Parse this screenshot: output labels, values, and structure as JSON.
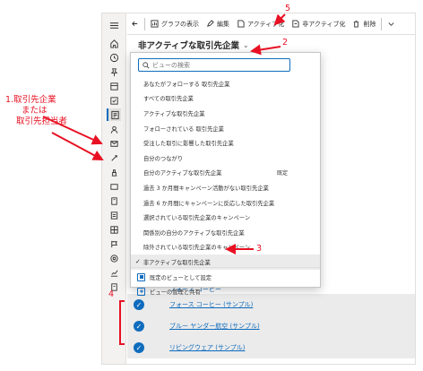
{
  "annotations": {
    "label1_line1": "1.取引先企業",
    "label1_line2": "または",
    "label1_line3": "取引先担当者",
    "num2": "2",
    "num3": "3",
    "num4": "4",
    "num5": "5",
    "color": "#e81123"
  },
  "command_bar": {
    "back_icon": "back-arrow-icon",
    "show_chart": "グラフの表示",
    "edit": "編集",
    "activate": "アクティブ化",
    "deactivate": "非アクティブ化",
    "delete": "削除",
    "more_icon": "chevron-down-icon"
  },
  "view_selector": {
    "title": "非アクティブな取引先企業",
    "chevron": "⌄"
  },
  "dropdown": {
    "search_placeholder": "ビューの検索",
    "views": [
      "あなたがフォローする 取引先企業",
      "すべての取引先企業",
      "アクティブな取引先企業",
      "フォローされている 取引先企業",
      "受注した取引に影響した取引先企業",
      "自分のつながり",
      "自分のアクティブな取引先企業",
      "過去 3 か月間キャンペーン活動がない取引先企業",
      "過去 6 か月間にキャンペーンに反応した取引先企業",
      "選択されている取引先企業のキャンペーン",
      "関係別の自分のアクティブな取引先企業",
      "除外されている取引先企業のキャンペーン"
    ],
    "default_tag": "既定",
    "selected_view": "非アクティブな取引先企業",
    "set_default": "既定のビューとして設定",
    "manage_share": "ビューの管理と共有"
  },
  "grid": {
    "partial_row": "フォース コーヒー",
    "rows": [
      "フォース コーヒー (サンプル)",
      "ブルー ヤンダー航空 (サンプル)",
      "リビングウェア (サンプル)"
    ]
  },
  "theme": {
    "accent": "#0f6cbd",
    "rail_bg": "#f3f2f1",
    "selected_row": "#ebebeb"
  }
}
